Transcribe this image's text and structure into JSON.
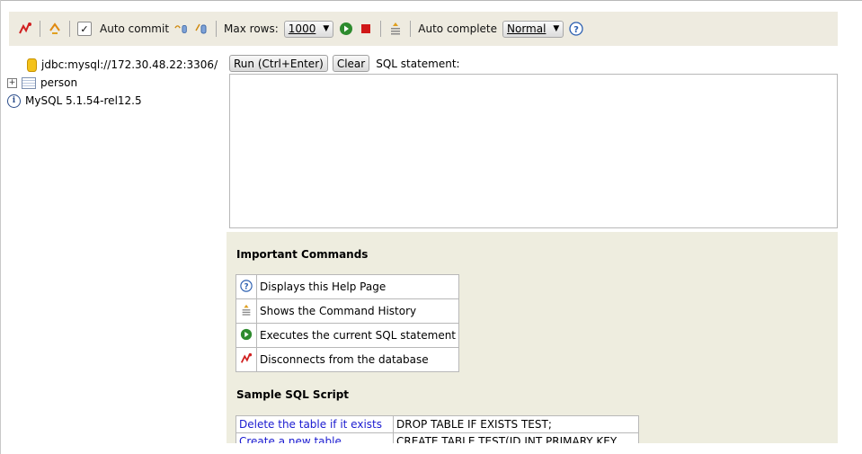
{
  "toolbar": {
    "auto_commit_label": "Auto commit",
    "max_rows_label": "Max rows:",
    "max_rows_value": "1000",
    "auto_complete_label": "Auto complete",
    "auto_complete_value": "Normal",
    "auto_commit_checked": true
  },
  "tree": {
    "connection": "jdbc:mysql://172.30.48.22:3306/",
    "table": "person",
    "server_info": "MySQL 5.1.54-rel12.5"
  },
  "editor": {
    "run_label": "Run (Ctrl+Enter)",
    "clear_label": "Clear",
    "sql_label": "SQL statement:",
    "value": ""
  },
  "help": {
    "important_title": "Important Commands",
    "commands": [
      {
        "icon": "help-icon",
        "text": "Displays this Help Page"
      },
      {
        "icon": "history-icon",
        "text": "Shows the Command History"
      },
      {
        "icon": "run-icon",
        "text": "Executes the current SQL statement"
      },
      {
        "icon": "disconnect-icon",
        "text": "Disconnects from the database"
      }
    ],
    "sample_title": "Sample SQL Script",
    "script": [
      {
        "link": "Delete the table if it exists",
        "sql": "DROP TABLE IF EXISTS TEST;"
      },
      {
        "link": "Create a new table",
        "sql": "CREATE TABLE TEST(ID INT PRIMARY KEY,"
      }
    ]
  },
  "colors": {
    "toolbar_bg": "#eeebe0",
    "help_bg": "#eeeddf",
    "run_green": "#2e8b2e",
    "stop_red": "#d01818",
    "link_blue": "#1a1ad0"
  }
}
